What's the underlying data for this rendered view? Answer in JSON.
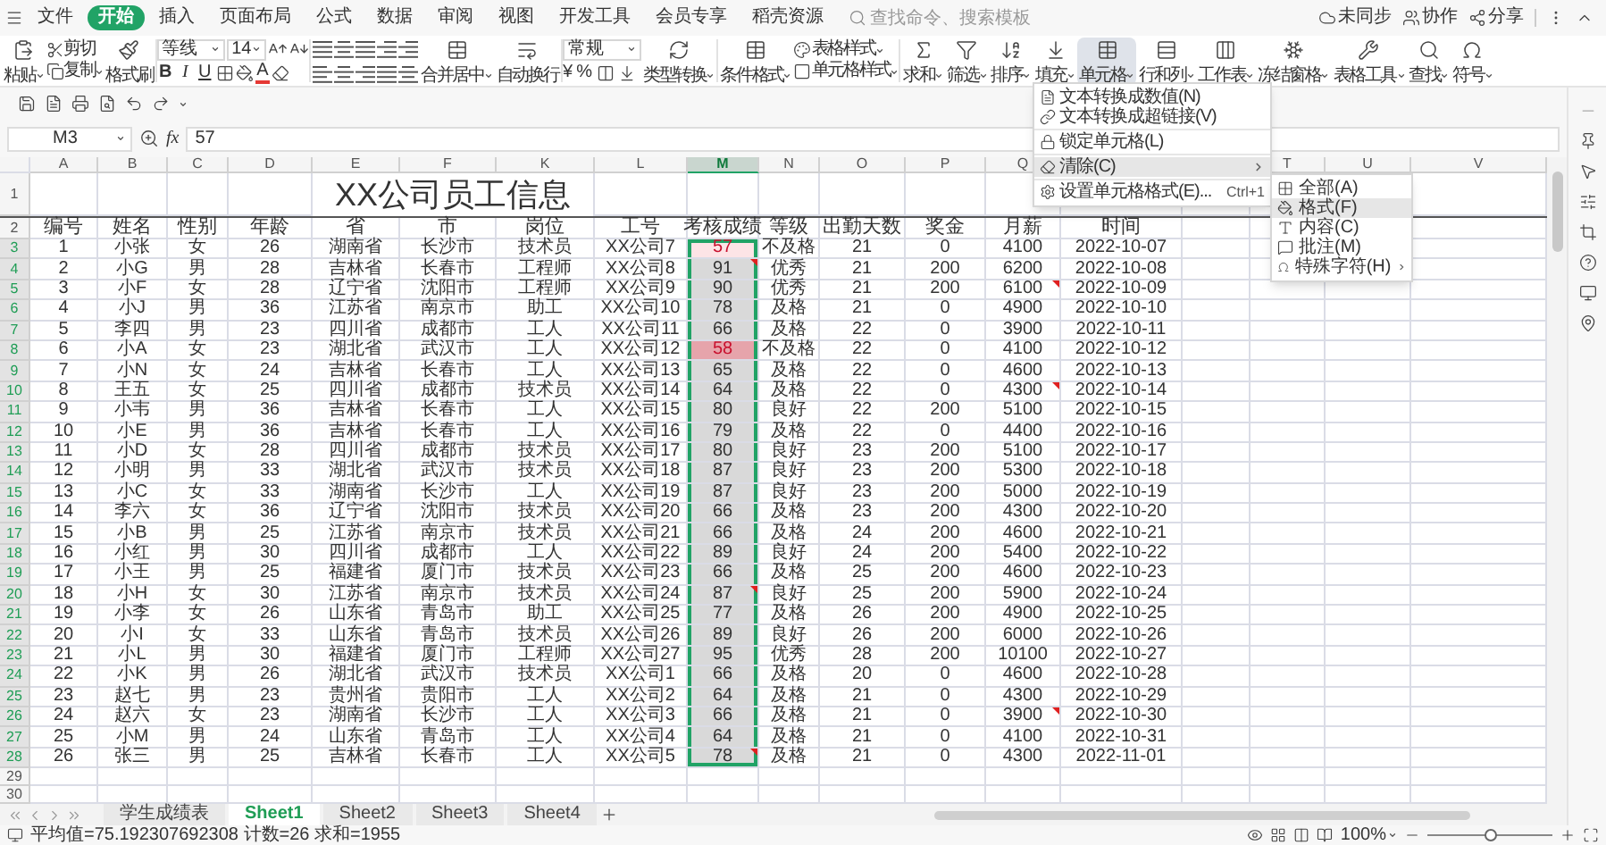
{
  "menu_bar": {
    "tabs": [
      {
        "label": "文件",
        "selected": false
      },
      {
        "label": "开始",
        "selected": true
      },
      {
        "label": "插入",
        "selected": false
      },
      {
        "label": "页面布局",
        "selected": false
      },
      {
        "label": "公式",
        "selected": false
      },
      {
        "label": "数据",
        "selected": false
      },
      {
        "label": "审阅",
        "selected": false
      },
      {
        "label": "视图",
        "selected": false
      },
      {
        "label": "开发工具",
        "selected": false
      },
      {
        "label": "会员专享",
        "selected": false
      },
      {
        "label": "稻壳资源",
        "selected": false
      }
    ],
    "search": {
      "placeholder": "查找命令、搜索模板"
    },
    "actions": [
      "未同步",
      "协作",
      "分享"
    ]
  },
  "ribbon": {
    "paste": {
      "label": "粘贴",
      "dropdown": true
    },
    "cut": {
      "label": "剪切",
      "dropdown": false
    },
    "copy": {
      "label": "复制",
      "dropdown": true
    },
    "painter": {
      "label": "格式刷",
      "dropdown": false
    },
    "font": {
      "value": "等线"
    },
    "size": {
      "value": "14"
    },
    "format_buttons": [
      {
        "label": "B",
        "kind": "bold"
      },
      {
        "label": "I",
        "kind": "italic"
      },
      {
        "label": "U",
        "kind": "underline"
      }
    ],
    "font_color": {
      "label": "A"
    },
    "merge": {
      "label": "合并居中",
      "dropdown": true
    },
    "wrap": {
      "label": "自动换行",
      "dropdown": false
    },
    "number_format": {
      "value": "常规"
    },
    "currency": {
      "label": "¥"
    },
    "percent": {
      "label": "%"
    },
    "convert": {
      "label": "类型转换",
      "dropdown": true
    },
    "conditional": {
      "label": "条件格式",
      "dropdown": true
    },
    "styles": [
      {
        "label": "表格样式",
        "dropdown": true
      },
      {
        "label": "单元格样式",
        "dropdown": true
      }
    ],
    "tools": [
      {
        "label": "求和",
        "dropdown": true,
        "active": false
      },
      {
        "label": "筛选",
        "dropdown": true,
        "active": false
      },
      {
        "label": "排序",
        "dropdown": true,
        "active": false
      },
      {
        "label": "填充",
        "dropdown": true,
        "active": false
      },
      {
        "label": "单元格",
        "dropdown": true,
        "active": true
      },
      {
        "label": "行和列",
        "dropdown": true,
        "active": false
      },
      {
        "label": "工作表",
        "dropdown": true,
        "active": false
      },
      {
        "label": "冻结窗格",
        "dropdown": true,
        "active": false
      },
      {
        "label": "表格工具",
        "dropdown": true,
        "active": false
      },
      {
        "label": "查找",
        "dropdown": true,
        "active": false
      },
      {
        "label": "符号",
        "dropdown": true,
        "active": false
      }
    ]
  },
  "name_box": {
    "value": "M3"
  },
  "formula": {
    "label": "fx",
    "value": "57"
  },
  "columns": [
    {
      "label": "A",
      "selected": false
    },
    {
      "label": "B",
      "selected": false
    },
    {
      "label": "C",
      "selected": false
    },
    {
      "label": "D",
      "selected": false
    },
    {
      "label": "E",
      "selected": false
    },
    {
      "label": "F",
      "selected": false
    },
    {
      "label": "K",
      "selected": false
    },
    {
      "label": "L",
      "selected": false
    },
    {
      "label": "M",
      "selected": true
    },
    {
      "label": "N",
      "selected": false
    },
    {
      "label": "O",
      "selected": false
    },
    {
      "label": "P",
      "selected": false
    },
    {
      "label": "Q",
      "selected": false
    },
    {
      "label": "T",
      "selected": false
    },
    {
      "label": "U",
      "selected": false
    },
    {
      "label": "V",
      "selected": false
    }
  ],
  "title_row": {
    "n": "1",
    "title": "XX公司员工信息"
  },
  "header_row": {
    "n": "2",
    "cells": [
      "编号",
      "姓名",
      "性别",
      "年龄",
      "省",
      "市",
      "岗位",
      "工号",
      "考核成绩",
      "等级",
      "出勤天数",
      "奖金",
      "月薪",
      "时间"
    ]
  },
  "rows": [
    {
      "n": "3",
      "selected": true,
      "active": true,
      "fail": true,
      "score_note": false,
      "salary_note": false,
      "cells": [
        "1",
        "小张",
        "女",
        "26",
        "湖南省",
        "长沙市",
        "技术员",
        "XX公司7",
        "57",
        "不及格",
        "21",
        "0",
        "4100",
        "2022-10-07"
      ]
    },
    {
      "n": "4",
      "selected": true,
      "active": false,
      "fail": false,
      "score_note": true,
      "salary_note": false,
      "cells": [
        "2",
        "小G",
        "男",
        "28",
        "吉林省",
        "长春市",
        "工程师",
        "XX公司8",
        "91",
        "优秀",
        "21",
        "200",
        "6200",
        "2022-10-08"
      ]
    },
    {
      "n": "5",
      "selected": true,
      "active": false,
      "fail": false,
      "score_note": false,
      "salary_note": true,
      "cells": [
        "3",
        "小F",
        "女",
        "28",
        "辽宁省",
        "沈阳市",
        "工程师",
        "XX公司9",
        "90",
        "优秀",
        "21",
        "200",
        "6100",
        "2022-10-09"
      ]
    },
    {
      "n": "6",
      "selected": true,
      "active": false,
      "fail": false,
      "score_note": false,
      "salary_note": false,
      "cells": [
        "4",
        "小J",
        "男",
        "36",
        "江苏省",
        "南京市",
        "助工",
        "XX公司10",
        "78",
        "及格",
        "21",
        "0",
        "4900",
        "2022-10-10"
      ]
    },
    {
      "n": "7",
      "selected": true,
      "active": false,
      "fail": false,
      "score_note": false,
      "salary_note": false,
      "cells": [
        "5",
        "李四",
        "男",
        "23",
        "四川省",
        "成都市",
        "工人",
        "XX公司11",
        "66",
        "及格",
        "22",
        "0",
        "3900",
        "2022-10-11"
      ]
    },
    {
      "n": "8",
      "selected": true,
      "active": false,
      "fail": true,
      "score_note": false,
      "salary_note": false,
      "cells": [
        "6",
        "小A",
        "女",
        "23",
        "湖北省",
        "武汉市",
        "工人",
        "XX公司12",
        "58",
        "不及格",
        "22",
        "0",
        "4100",
        "2022-10-12"
      ]
    },
    {
      "n": "9",
      "selected": true,
      "active": false,
      "fail": false,
      "score_note": false,
      "salary_note": false,
      "cells": [
        "7",
        "小N",
        "女",
        "24",
        "吉林省",
        "长春市",
        "工人",
        "XX公司13",
        "65",
        "及格",
        "22",
        "0",
        "4600",
        "2022-10-13"
      ]
    },
    {
      "n": "10",
      "selected": true,
      "active": false,
      "fail": false,
      "score_note": false,
      "salary_note": true,
      "cells": [
        "8",
        "王五",
        "女",
        "25",
        "四川省",
        "成都市",
        "技术员",
        "XX公司14",
        "64",
        "及格",
        "22",
        "0",
        "4300",
        "2022-10-14"
      ]
    },
    {
      "n": "11",
      "selected": true,
      "active": false,
      "fail": false,
      "score_note": false,
      "salary_note": false,
      "cells": [
        "9",
        "小韦",
        "男",
        "36",
        "吉林省",
        "长春市",
        "工人",
        "XX公司15",
        "80",
        "良好",
        "22",
        "200",
        "5100",
        "2022-10-15"
      ]
    },
    {
      "n": "12",
      "selected": true,
      "active": false,
      "fail": false,
      "score_note": false,
      "salary_note": false,
      "cells": [
        "10",
        "小E",
        "男",
        "36",
        "吉林省",
        "长春市",
        "工人",
        "XX公司16",
        "79",
        "及格",
        "22",
        "0",
        "4400",
        "2022-10-16"
      ]
    },
    {
      "n": "13",
      "selected": true,
      "active": false,
      "fail": false,
      "score_note": false,
      "salary_note": false,
      "cells": [
        "11",
        "小D",
        "女",
        "28",
        "四川省",
        "成都市",
        "技术员",
        "XX公司17",
        "80",
        "良好",
        "23",
        "200",
        "5100",
        "2022-10-17"
      ]
    },
    {
      "n": "14",
      "selected": true,
      "active": false,
      "fail": false,
      "score_note": false,
      "salary_note": false,
      "cells": [
        "12",
        "小明",
        "男",
        "33",
        "湖北省",
        "武汉市",
        "技术员",
        "XX公司18",
        "87",
        "良好",
        "23",
        "200",
        "5300",
        "2022-10-18"
      ]
    },
    {
      "n": "15",
      "selected": true,
      "active": false,
      "fail": false,
      "score_note": false,
      "salary_note": false,
      "cells": [
        "13",
        "小C",
        "女",
        "33",
        "湖南省",
        "长沙市",
        "工人",
        "XX公司19",
        "87",
        "良好",
        "23",
        "200",
        "5000",
        "2022-10-19"
      ]
    },
    {
      "n": "16",
      "selected": true,
      "active": false,
      "fail": false,
      "score_note": false,
      "salary_note": false,
      "cells": [
        "14",
        "李六",
        "女",
        "36",
        "辽宁省",
        "沈阳市",
        "技术员",
        "XX公司20",
        "66",
        "及格",
        "23",
        "200",
        "4300",
        "2022-10-20"
      ]
    },
    {
      "n": "17",
      "selected": true,
      "active": false,
      "fail": false,
      "score_note": false,
      "salary_note": false,
      "cells": [
        "15",
        "小B",
        "男",
        "25",
        "江苏省",
        "南京市",
        "技术员",
        "XX公司21",
        "66",
        "及格",
        "24",
        "200",
        "4600",
        "2022-10-21"
      ]
    },
    {
      "n": "18",
      "selected": true,
      "active": false,
      "fail": false,
      "score_note": false,
      "salary_note": false,
      "cells": [
        "16",
        "小红",
        "男",
        "30",
        "四川省",
        "成都市",
        "工人",
        "XX公司22",
        "89",
        "良好",
        "24",
        "200",
        "5400",
        "2022-10-22"
      ]
    },
    {
      "n": "19",
      "selected": true,
      "active": false,
      "fail": false,
      "score_note": false,
      "salary_note": false,
      "cells": [
        "17",
        "小王",
        "男",
        "25",
        "福建省",
        "厦门市",
        "技术员",
        "XX公司23",
        "66",
        "及格",
        "25",
        "200",
        "4600",
        "2022-10-23"
      ]
    },
    {
      "n": "20",
      "selected": true,
      "active": false,
      "fail": false,
      "score_note": true,
      "salary_note": false,
      "cells": [
        "18",
        "小H",
        "女",
        "30",
        "江苏省",
        "南京市",
        "技术员",
        "XX公司24",
        "87",
        "良好",
        "25",
        "200",
        "5900",
        "2022-10-24"
      ]
    },
    {
      "n": "21",
      "selected": true,
      "active": false,
      "fail": false,
      "score_note": false,
      "salary_note": false,
      "cells": [
        "19",
        "小李",
        "女",
        "26",
        "山东省",
        "青岛市",
        "助工",
        "XX公司25",
        "77",
        "及格",
        "26",
        "200",
        "4900",
        "2022-10-25"
      ]
    },
    {
      "n": "22",
      "selected": true,
      "active": false,
      "fail": false,
      "score_note": false,
      "salary_note": false,
      "cells": [
        "20",
        "小I",
        "女",
        "33",
        "山东省",
        "青岛市",
        "技术员",
        "XX公司26",
        "89",
        "良好",
        "26",
        "200",
        "6000",
        "2022-10-26"
      ]
    },
    {
      "n": "23",
      "selected": true,
      "active": false,
      "fail": false,
      "score_note": false,
      "salary_note": false,
      "cells": [
        "21",
        "小L",
        "男",
        "30",
        "福建省",
        "厦门市",
        "工程师",
        "XX公司27",
        "95",
        "优秀",
        "28",
        "200",
        "10100",
        "2022-10-27"
      ]
    },
    {
      "n": "24",
      "selected": true,
      "active": false,
      "fail": false,
      "score_note": false,
      "salary_note": false,
      "cells": [
        "22",
        "小K",
        "男",
        "26",
        "湖北省",
        "武汉市",
        "技术员",
        "XX公司1",
        "66",
        "及格",
        "20",
        "0",
        "4600",
        "2022-10-28"
      ]
    },
    {
      "n": "25",
      "selected": true,
      "active": false,
      "fail": false,
      "score_note": false,
      "salary_note": false,
      "cells": [
        "23",
        "赵七",
        "男",
        "23",
        "贵州省",
        "贵阳市",
        "工人",
        "XX公司2",
        "64",
        "及格",
        "21",
        "0",
        "4300",
        "2022-10-29"
      ]
    },
    {
      "n": "26",
      "selected": true,
      "active": false,
      "fail": false,
      "score_note": false,
      "salary_note": true,
      "cells": [
        "24",
        "赵六",
        "女",
        "23",
        "湖南省",
        "长沙市",
        "工人",
        "XX公司3",
        "66",
        "及格",
        "21",
        "0",
        "3900",
        "2022-10-30"
      ]
    },
    {
      "n": "27",
      "selected": true,
      "active": false,
      "fail": false,
      "score_note": false,
      "salary_note": false,
      "cells": [
        "25",
        "小M",
        "男",
        "24",
        "山东省",
        "青岛市",
        "工人",
        "XX公司4",
        "64",
        "及格",
        "21",
        "0",
        "4100",
        "2022-10-31"
      ]
    },
    {
      "n": "28",
      "selected": true,
      "active": false,
      "fail": false,
      "score_note": true,
      "salary_note": false,
      "cells": [
        "26",
        "张三",
        "男",
        "25",
        "吉林省",
        "长春市",
        "工人",
        "XX公司5",
        "78",
        "及格",
        "21",
        "0",
        "4300",
        "2022-11-01"
      ]
    }
  ],
  "empty_rows": [
    {
      "n": "29"
    },
    {
      "n": "30"
    }
  ],
  "sheet_tabs": [
    {
      "label": "学生成绩表",
      "selected": false
    },
    {
      "label": "Sheet1",
      "selected": true
    },
    {
      "label": "Sheet2",
      "selected": false
    },
    {
      "label": "Sheet3",
      "selected": false
    },
    {
      "label": "Sheet4",
      "selected": false
    }
  ],
  "status": {
    "text": "平均值=75.192307692308 计数=26 求和=1955",
    "zoom": "100%",
    "zoom_slider": {
      "level": 0.5
    }
  },
  "cell_menu": {
    "items": [
      {
        "label": "文本转换成数值(N)",
        "separator_before": false,
        "submenu": false,
        "selected": false
      },
      {
        "label": "文本转换成超链接(V)",
        "separator_before": false,
        "submenu": false,
        "selected": false
      },
      {
        "label": "锁定单元格(L)",
        "separator_before": true,
        "submenu": false,
        "selected": false
      },
      {
        "label": "清除(C)",
        "separator_before": true,
        "submenu": true,
        "selected": true
      },
      {
        "label": "设置单元格格式(E)...",
        "shortcut": "Ctrl+1",
        "separator_before": true,
        "submenu": false,
        "selected": false
      }
    ]
  },
  "clear_menu": {
    "items": [
      {
        "label": "全部(A)",
        "submenu": false,
        "selected": false
      },
      {
        "label": "格式(F)",
        "submenu": false,
        "selected": true
      },
      {
        "label": "内容(C)",
        "submenu": false,
        "selected": false
      },
      {
        "label": "批注(M)",
        "submenu": false,
        "selected": false
      },
      {
        "label": "特殊字符(H)",
        "submenu": true,
        "selected": false
      }
    ]
  }
}
